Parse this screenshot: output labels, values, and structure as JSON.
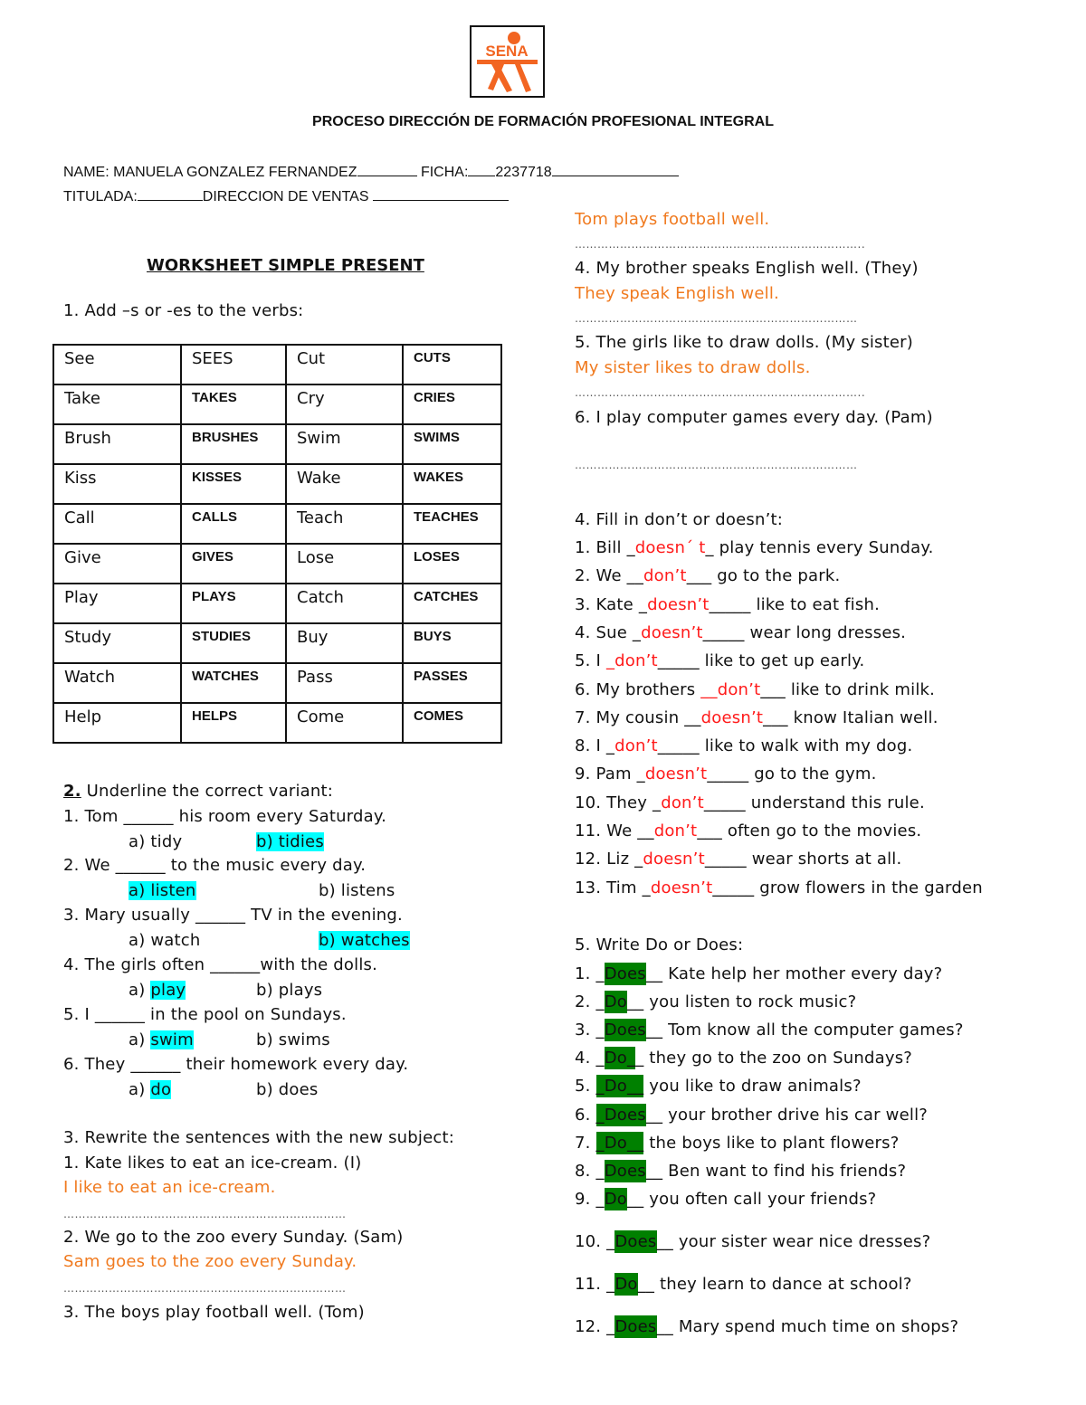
{
  "logo": {
    "text": "SENA",
    "color": "#f26522"
  },
  "header": {
    "process_title": "PROCESO DIRECCIÓN DE FORMACIÓN PROFESIONAL INTEGRAL",
    "name_label": "NAME:",
    "name_value": "MANUELA GONZALEZ FERNANDEZ",
    "ficha_label": "FICHA:",
    "ficha_value": "2237718",
    "titulada_label": "TITULADA:",
    "titulada_value": "DIRECCION DE VENTAS"
  },
  "worksheet_title": "WORKSHEET SIMPLE PRESENT",
  "section1": {
    "title": "1. Add –s or -es to the verbs:",
    "rows": [
      [
        "See",
        "SEES",
        "Cut",
        "CUTS"
      ],
      [
        "Take",
        "TAKES",
        "Cry",
        "CRIES"
      ],
      [
        "Brush",
        "BRUSHES",
        "Swim",
        "SWIMS"
      ],
      [
        "Kiss",
        "KISSES",
        "Wake",
        "WAKES"
      ],
      [
        "Call",
        "CALLS",
        "Teach",
        "TEACHES"
      ],
      [
        "Give",
        "GIVES",
        "Lose",
        "LOSES"
      ],
      [
        "Play",
        "PLAYS",
        "Catch",
        "CATCHES"
      ],
      [
        "Study",
        "STUDIES",
        "Buy",
        "BUYS"
      ],
      [
        "Watch",
        "WATCHES",
        "Pass",
        "PASSES"
      ],
      [
        "Help",
        "HELPS",
        "Come",
        "COMES"
      ]
    ]
  },
  "section2": {
    "number": "2.",
    "title": " Underline the correct variant:",
    "items": [
      {
        "q": "1. Tom ______ his room every Saturday.",
        "a": "a) tidy",
        "b": "b) tidies",
        "selected": "b"
      },
      {
        "q": "2. We ______ to the music every day.",
        "a": "a) listen",
        "b": "b) listens",
        "selected": "a"
      },
      {
        "q": "3. Mary usually ______ TV in the evening.",
        "a": "a) watch",
        "b": "b) watches",
        "selected": "b"
      },
      {
        "q": "4. The girls often ______with the dolls.",
        "a_prefix": "a) ",
        "a_word": "play",
        "b": "b) plays",
        "selected": "a"
      },
      {
        "q": "5. I ______ in the pool on Sundays.",
        "a_prefix": "a) ",
        "a_word": "swim",
        "b": "b) swims",
        "selected": "a"
      },
      {
        "q": "6. They ______ their homework every day.",
        "a_prefix": "a) ",
        "a_word": "do",
        "b": "b) does",
        "selected": "a"
      }
    ]
  },
  "section3": {
    "title": "3. Rewrite the sentences with the new subject:",
    "dots": "…………………………………………………………………",
    "dots_end": "…………………………………………………………………..",
    "items": [
      {
        "q": "1. Kate likes to eat an ice-cream. (I)",
        "answer": "I like to eat an ice-cream."
      },
      {
        "q": "2. We go to the zoo every Sunday. (Sam)",
        "answer": "Sam goes to the zoo every Sunday."
      },
      {
        "q": "3. The boys play football well. (Tom)",
        "answer": "Tom plays football well."
      },
      {
        "q": "4. My brother speaks English well. (They)",
        "answer": "They speak English well."
      },
      {
        "q": "5. The girls like to draw dolls. (My sister)",
        "answer": "My sister likes to draw dolls."
      },
      {
        "q": "6. I play computer games every day. (Pam)",
        "answer": ""
      }
    ]
  },
  "section4": {
    "title": "4. Fill in don’t or doesn’t:",
    "items": [
      {
        "pre": "1. Bill _",
        "ans": "doesn´ t",
        "post": "_ play tennis every Sunday."
      },
      {
        "pre": "2. We __",
        "ans": "don’t",
        "post": "___ go to the park."
      },
      {
        "pre": "3. Kate _",
        "ans": "doesn’t",
        "post": "_____ like to eat fish."
      },
      {
        "pre": "4. Sue _",
        "ans": "doesn’t",
        "post": "_____ wear long dresses."
      },
      {
        "pre": "5. I ",
        "ans": "_don’t",
        "post": "_____ like to get up early."
      },
      {
        "pre": "6. My brothers ",
        "ans": "__don’t",
        "post": "___ like to drink milk."
      },
      {
        "pre": "7. My cousin __",
        "ans": "doesn’t",
        "post": "___ know Italian well."
      },
      {
        "pre": "8. I _",
        "ans": "don’t",
        "post": "_____ like to walk with my dog."
      },
      {
        "pre": "9. Pam _",
        "ans": "doesn’t",
        "post": "_____ go to the gym."
      },
      {
        "pre": "10. They _",
        "ans": "don’t",
        "post": "_____ understand this rule."
      },
      {
        "pre": "11. We __",
        "ans": "don’t",
        "post": "___ often go to the movies."
      },
      {
        "pre": "12. Liz _",
        "ans": "doesn’t",
        "post": "_____ wear shorts at all."
      },
      {
        "pre": "13. Tim _",
        "ans": "doesn’t",
        "post": "_____ grow flowers in the garden"
      }
    ]
  },
  "section5": {
    "title": "5. Write Do or Does:",
    "items": [
      {
        "num": "1. _",
        "ans": "Does",
        "post": "__ Kate help her mother every day?"
      },
      {
        "num": "2. _",
        "ans": "Do",
        "post": "__ you listen to rock music?"
      },
      {
        "num": "3. _",
        "ans": "Does",
        "post": "__ Tom know all the computer games?"
      },
      {
        "num": "4. _",
        "ans": "Do_",
        "post": "_ they go to the zoo on Sundays?"
      },
      {
        "num": "5. ",
        "ans": "_Do__",
        "post": " you like to draw animals?"
      },
      {
        "num": "6. ",
        "ans": "_Does",
        "post": "__ your brother drive his car well?"
      },
      {
        "num": "7. ",
        "ans": "_Do__",
        "post": " the boys like to plant flowers?"
      },
      {
        "num": "8. _",
        "ans": "Does",
        "post": "__ Ben want to find his friends?"
      },
      {
        "num": "9. _",
        "ans": "Do",
        "post": "__ you often call your friends?"
      },
      {
        "num": "10. _",
        "ans": "Does",
        "post": "__ your sister wear nice dresses?"
      },
      {
        "num": "11. _",
        "ans": "Do",
        "post": "__ they learn to dance at school?"
      },
      {
        "num": "12. _",
        "ans": "Does",
        "post": "__ Mary spend much time on shops?"
      }
    ]
  },
  "colors": {
    "answer_orange": "#f07a1f",
    "answer_red": "#ff1a1a",
    "highlight_cyan": "#00ffff",
    "highlight_green": "#008000"
  }
}
